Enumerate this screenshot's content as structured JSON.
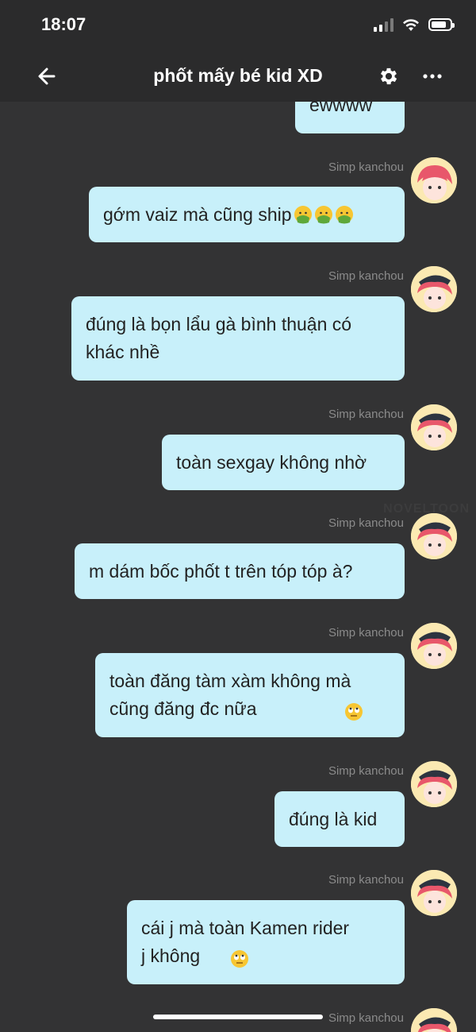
{
  "status": {
    "time": "18:07"
  },
  "nav": {
    "title": "phốt mấy bé kid XD"
  },
  "watermark": "NOVELTOON",
  "messages": [
    {
      "text": "ewwww",
      "emoji": []
    },
    {
      "sender": "Simp kanchou",
      "text": "gớm vaiz mà cũng ship",
      "emoji": [
        "nauseated-face",
        "nauseated-face",
        "nauseated-face"
      ]
    },
    {
      "sender": "Simp kanchou",
      "text": "đúng là bọn lẩu gà bình thuận có\nkhác nhề",
      "emoji": []
    },
    {
      "sender": "Simp kanchou",
      "text": "toàn sexgay không nhờ",
      "emoji": []
    },
    {
      "sender": "Simp kanchou",
      "text": "m dám bốc phốt t trên tóp tóp à?",
      "emoji": []
    },
    {
      "sender": "Simp kanchou",
      "text": "toàn đăng tàm xàm không mà\ncũng đăng đc nữa",
      "emoji": [
        "eye-roll-face"
      ]
    },
    {
      "sender": "Simp kanchou",
      "text": "đúng là kid",
      "emoji": []
    },
    {
      "sender": "Simp kanchou",
      "text": "cái j mà toàn Kamen rider\nj không",
      "emoji": [
        "eye-roll-face"
      ]
    },
    {
      "sender": "Simp kanchou"
    }
  ]
}
